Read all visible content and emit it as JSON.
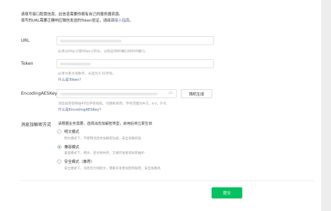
{
  "intro": {
    "line1": "请填写接口配置信息，此信息需要你拥有自己的服务器资源。",
    "line2_prefix": "填写的URL需要正确响应微信发送的Token验证，请阅读",
    "line2_link": "接入指南",
    "line2_suffix": "。"
  },
  "fields": {
    "url": {
      "label": "URL",
      "hint": "必须以http://或https://开头，分别支持80端口和443端口。"
    },
    "token": {
      "label": "Token",
      "hint": "必须为英文或数字，长度为3-32字符。",
      "help_link": "什么是Token?"
    },
    "aeskey": {
      "label": "EncodingAESKey",
      "counter": "43",
      "random_button": "随机生成",
      "hint": "消息加密密钥由43位字符组成，可随机修改，字符范围为A-Z，a-z，0-9。",
      "help_link": "什么是EncodingAESKey?"
    }
  },
  "encryption": {
    "label": "消息加解密方式",
    "intro": "请根据业务需要，选择消息加解密类型，启用后将立即生效",
    "options": [
      {
        "label": "明文模式",
        "desc": "明文模式下，不使用消息体加解密功能，安全系数较低",
        "checked": false
      },
      {
        "label": "兼容模式",
        "desc": "兼容模式下，明文、密文将共存，方便开发者调试和维护",
        "checked": true
      },
      {
        "label": "安全模式（推荐）",
        "desc": "安全模式下，消息包为纯密文，需要开发者加密和解密，安全系数高",
        "checked": false
      }
    ]
  },
  "actions": {
    "submit": "提交"
  },
  "colors": {
    "accent": "#07c160",
    "link": "#576b95"
  }
}
